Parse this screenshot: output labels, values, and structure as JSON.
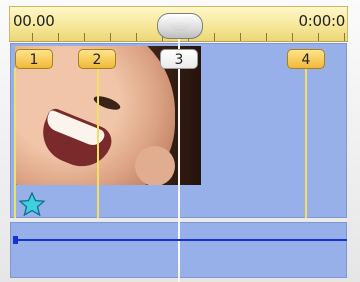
{
  "ruler": {
    "start_timecode": "00.00",
    "end_timecode": "0:00:0"
  },
  "markers": [
    {
      "label": "1",
      "selected": false
    },
    {
      "label": "2",
      "selected": false
    },
    {
      "label": "3",
      "selected": true
    },
    {
      "label": "4",
      "selected": false
    }
  ],
  "colors": {
    "track": "#98b0ea",
    "marker": "#f1b83a",
    "ruler": "#f6e79a",
    "audio_line": "#1233d6"
  },
  "icons": {
    "clip_thumbnail": "face-photo-thumbnail",
    "effect": "star-icon"
  }
}
